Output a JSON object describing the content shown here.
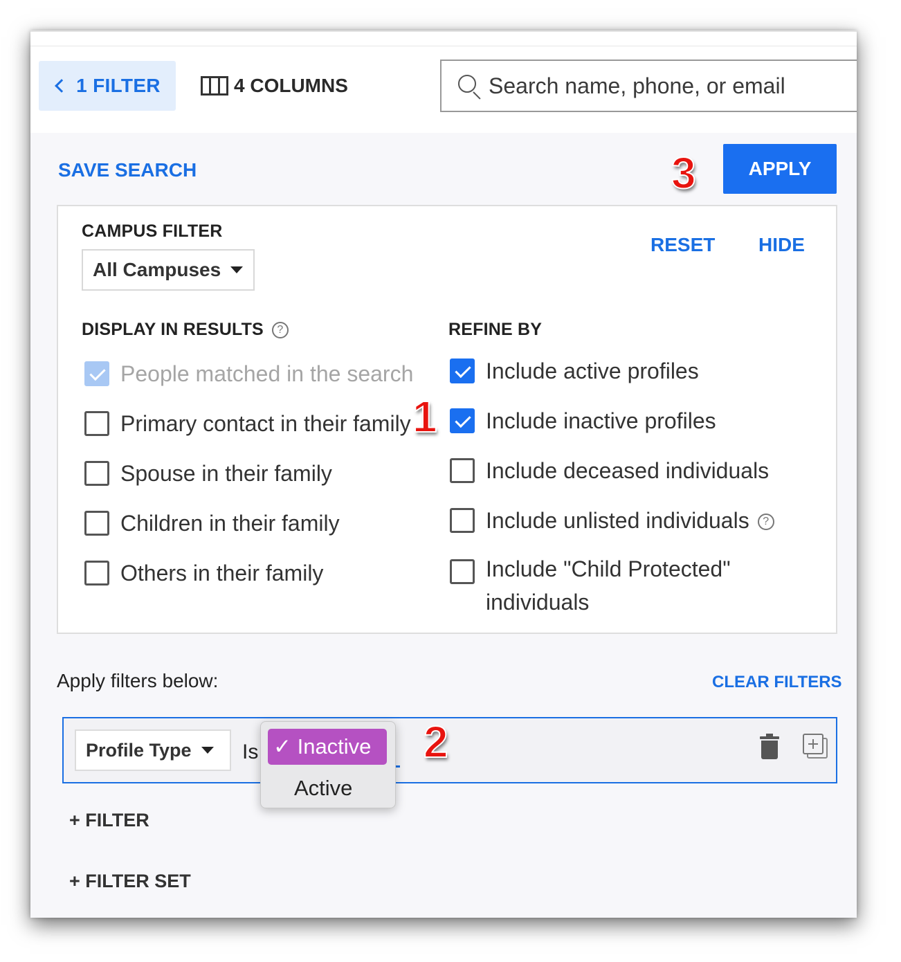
{
  "toolbar": {
    "filter_toggle_label": "1 FILTER",
    "columns_label": "4 COLUMNS",
    "search_placeholder": "Search name, phone, or email"
  },
  "actions": {
    "save_search": "SAVE SEARCH",
    "apply": "APPLY"
  },
  "panel": {
    "campus_filter_label": "CAMPUS FILTER",
    "campus_selected": "All Campuses",
    "reset": "RESET",
    "hide": "HIDE",
    "display_label": "DISPLAY IN RESULTS",
    "display_options": [
      {
        "label": "People matched in the search",
        "checked": true,
        "disabled": true
      },
      {
        "label": "Primary contact in their family",
        "checked": false
      },
      {
        "label": "Spouse in their family",
        "checked": false
      },
      {
        "label": "Children in their family",
        "checked": false
      },
      {
        "label": "Others in their family",
        "checked": false
      }
    ],
    "refine_label": "REFINE BY",
    "refine_options": [
      {
        "label": "Include active profiles",
        "checked": true
      },
      {
        "label": "Include inactive profiles",
        "checked": true
      },
      {
        "label": "Include deceased individuals",
        "checked": false
      },
      {
        "label": "Include unlisted individuals",
        "checked": false,
        "help": true
      },
      {
        "label": "Include \"Child Protected\" individuals",
        "checked": false
      }
    ]
  },
  "filters": {
    "apply_below_label": "Apply filters below:",
    "clear_filters": "CLEAR FILTERS",
    "row": {
      "field": "Profile Type",
      "operator": "Is",
      "dropdown_options": [
        {
          "label": "✓ Inactive",
          "selected": true
        },
        {
          "label": "Active",
          "selected": false
        }
      ]
    },
    "add_filter": "+ FILTER",
    "add_filter_set": "+ FILTER SET"
  },
  "callouts": [
    "1",
    "2",
    "3"
  ],
  "colors": {
    "accent": "#1a6fe3",
    "apply_button": "#1a6ff0",
    "dropdown_highlight": "#b551c2",
    "callout": "#e8140f"
  }
}
